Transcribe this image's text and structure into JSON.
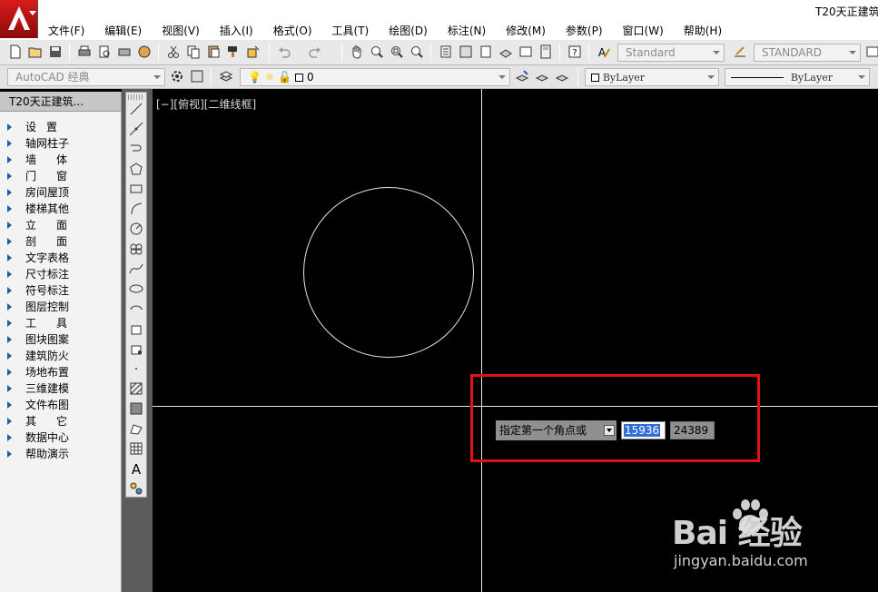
{
  "window": {
    "title": "T20天正建筑"
  },
  "menu": [
    "文件(F)",
    "编辑(E)",
    "视图(V)",
    "插入(I)",
    "格式(O)",
    "工具(T)",
    "绘图(D)",
    "标注(N)",
    "修改(M)",
    "参数(P)",
    "窗口(W)",
    "帮助(H)"
  ],
  "toolbar": {
    "text_style": "Standard",
    "dim_style": "STANDARD",
    "workspace": "AutoCAD 经典",
    "layer_name": "0",
    "color": "ByLayer",
    "linetype": "ByLayer"
  },
  "palette": {
    "title": "T20天正建筑...",
    "items": [
      "设置",
      "轴网柱子",
      "墙体",
      "门窗",
      "房间屋顶",
      "楼梯其他",
      "立面",
      "剖面",
      "文字表格",
      "尺寸标注",
      "符号标注",
      "图层控制",
      "工具",
      "图块图案",
      "建筑防火",
      "场地布置",
      "三维建模",
      "文件布图",
      "其它",
      "数据中心",
      "帮助演示"
    ]
  },
  "viewport": {
    "label": "[−][俯视][二维线框]"
  },
  "dynamic_input": {
    "prompt": "指定第一个角点或",
    "x_value": "15936",
    "y_value": "24389"
  },
  "watermark": {
    "logo": "Bai  经验",
    "url": "jingyan.baidu.com"
  },
  "colors": {
    "canvas": "#000000",
    "highlight": "#e41111",
    "selection": "#2f6fd6"
  }
}
